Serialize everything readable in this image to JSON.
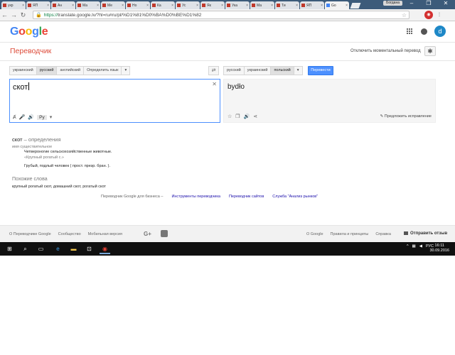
{
  "browser": {
    "tabs": [
      {
        "label": "укр"
      },
      {
        "label": "ЯП"
      },
      {
        "label": "Ан"
      },
      {
        "label": "Ма"
      },
      {
        "label": "Ме"
      },
      {
        "label": "Но"
      },
      {
        "label": "Ка"
      },
      {
        "label": "Ус"
      },
      {
        "label": "Як"
      },
      {
        "label": "Ука"
      },
      {
        "label": "Ма"
      },
      {
        "label": "Ти"
      },
      {
        "label": "ЯП"
      },
      {
        "label": "Go",
        "active": true
      }
    ],
    "user": "Богдана",
    "url_secure_part": "https://",
    "url_rest": "translate.google.lv/?hl=ru#ru/pl/%D1%81%D0%BA%D0%BE%D1%82"
  },
  "header": {
    "logo_letters": [
      {
        "ch": "G",
        "color": "#4285f4"
      },
      {
        "ch": "o",
        "color": "#ea4335"
      },
      {
        "ch": "o",
        "color": "#fbbc05"
      },
      {
        "ch": "g",
        "color": "#4285f4"
      },
      {
        "ch": "l",
        "color": "#34a853"
      },
      {
        "ch": "e",
        "color": "#ea4335"
      }
    ],
    "avatar_letter": "d",
    "product_title": "Переводчик",
    "instant_off": "Отключить моментальный перевод"
  },
  "source_langs": [
    "украинский",
    "русский",
    "английский",
    "Определить язык"
  ],
  "source_selected": 1,
  "target_langs": [
    "русский",
    "украинский",
    "польский"
  ],
  "target_selected": 2,
  "translate_button": "Перевести",
  "source": {
    "text": "скот",
    "ime_label": "Ру"
  },
  "result": {
    "text": "bydło",
    "suggest": "Предложить исправление"
  },
  "definitions": {
    "word": "скот",
    "heading_suffix": " – определения",
    "pos": "имя существительное",
    "items": [
      {
        "def": "Четвероногие сельскохозяйственные животные.",
        "example": "«Крупный рогатый с.»"
      },
      {
        "def": "Грубый, подлый человек ( прост. презр. бран. )."
      }
    ],
    "similar_title": "Похожие слова",
    "similar_words": "крупный рогатый скот, домашний скот, рогатый скот"
  },
  "business": {
    "lead": "Переводчик Google для бизнеса –",
    "links": [
      "Инструменты переводчика",
      "Переводчик сайтов",
      "Служба \"Анализ рынков\""
    ]
  },
  "footer": {
    "left": [
      "О Переводчике Google",
      "Сообщество",
      "Мобильная версия"
    ],
    "right": [
      "О Google",
      "Правила и принципы",
      "Справка"
    ],
    "feedback": "Отправить отзыв"
  },
  "taskbar": {
    "lang": "РУС",
    "time": "16:11",
    "date": "30.09.2016"
  }
}
